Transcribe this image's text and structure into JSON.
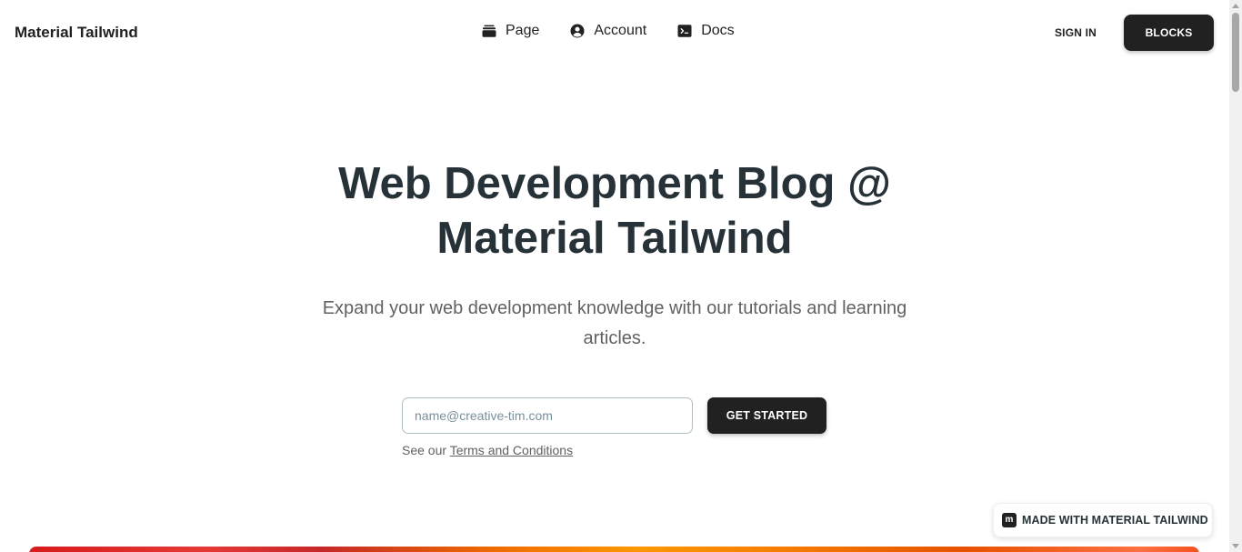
{
  "brand": "Material Tailwind",
  "nav": {
    "items": [
      {
        "label": "Page",
        "icon": "rectangle-stack-icon"
      },
      {
        "label": "Account",
        "icon": "user-circle-icon"
      },
      {
        "label": "Docs",
        "icon": "command-line-icon"
      }
    ],
    "signin_label": "SIGN IN",
    "blocks_label": "BLOCKS"
  },
  "hero": {
    "title_line1": "Web Development Blog @",
    "title_line2": "Material Tailwind",
    "subtitle": "Expand your web development knowledge with our tutorials and learning articles.",
    "email_placeholder": "name@creative-tim.com",
    "cta_label": "GET STARTED",
    "terms_prefix": "See our",
    "terms_link": "Terms and Conditions"
  },
  "badge": {
    "logo_letter": "m",
    "label": "MADE WITH MATERIAL TAILWIND"
  },
  "colors": {
    "primary": "#212121",
    "title": "#263238",
    "muted": "#616161"
  }
}
